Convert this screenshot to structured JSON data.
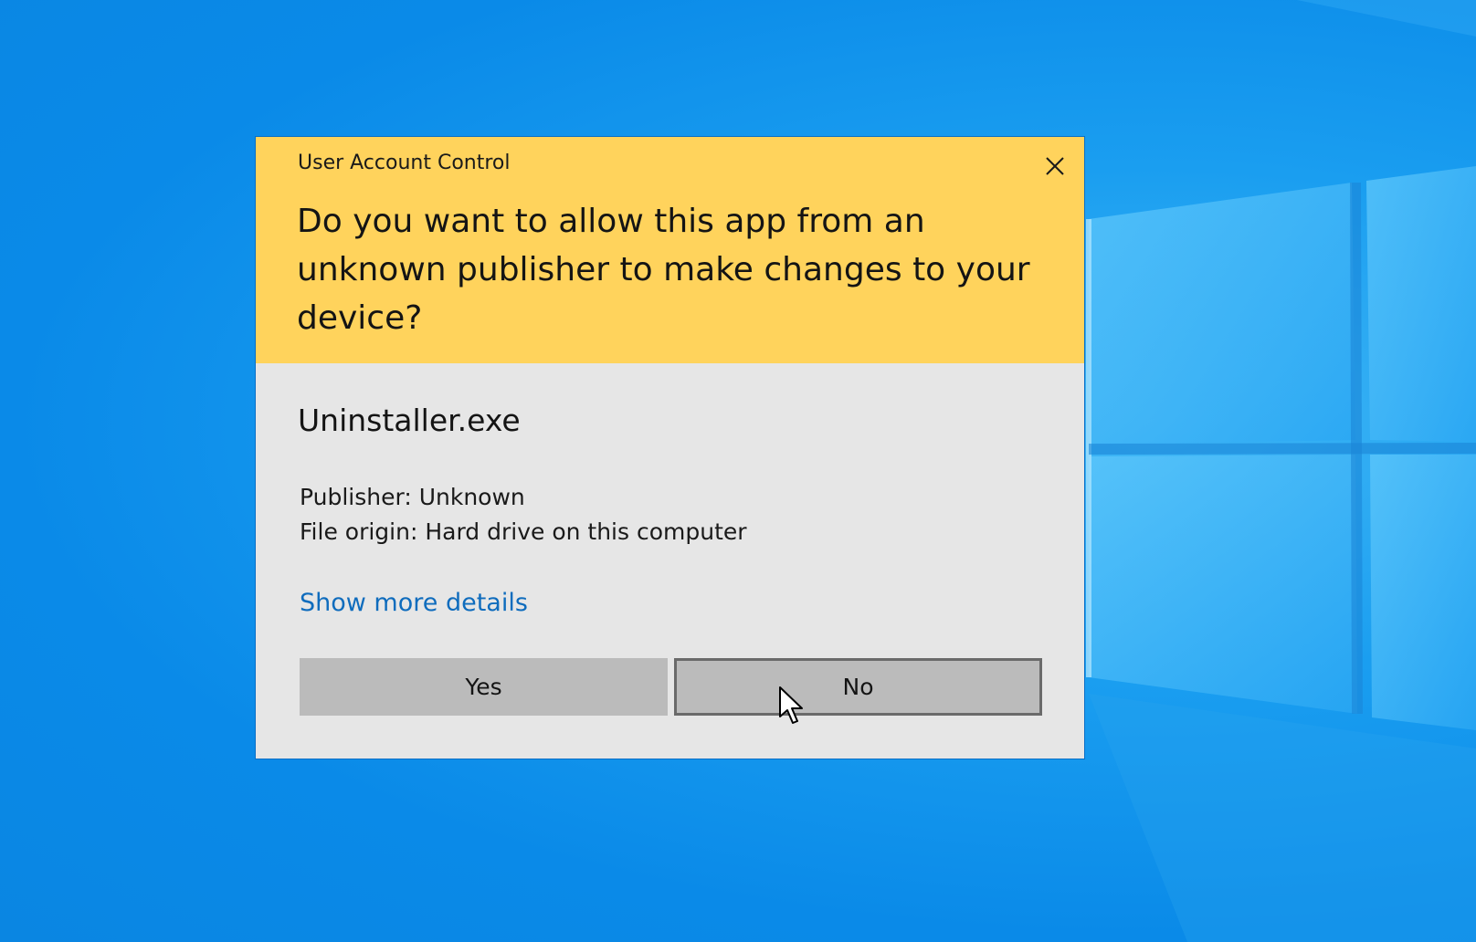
{
  "dialog": {
    "title": "User Account Control",
    "question": "Do you want to allow this app from an unknown publisher to make changes to your device?",
    "app_name": "Uninstaller.exe",
    "publisher": "Publisher: Unknown",
    "file_origin": "File origin: Hard drive on this computer",
    "details_link": "Show more details",
    "yes_label": "Yes",
    "no_label": "No",
    "close_icon": "close-icon"
  },
  "colors": {
    "header_bg": "#ffd35c",
    "body_bg": "#e6e6e6",
    "button_bg": "#bbbbbb",
    "link": "#0f6cbd",
    "desktop_blue": "#0a8ae8"
  }
}
